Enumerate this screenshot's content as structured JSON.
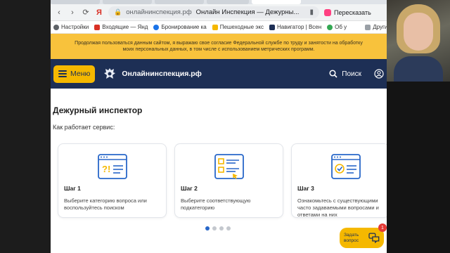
{
  "browser": {
    "url": "онлайнинспекция.рф",
    "page_title": "Онлайн Инспекция — Дежурны...",
    "retell_label": "Пересказать"
  },
  "bookmarks": [
    {
      "label": "Настройки",
      "color": "#5f6368"
    },
    {
      "label": "Входящие — Янд",
      "color": "#d93025"
    },
    {
      "label": "Бронирование ка",
      "color": "#1a73e8"
    },
    {
      "label": "Пешеходные экс",
      "color": "#f5b800"
    },
    {
      "label": "Навигатор | Всен",
      "color": "#1d2f55"
    },
    {
      "label": "Об у",
      "color": "#34a853"
    },
    {
      "label": "Другие закла",
      "color": "#5f6368"
    }
  ],
  "notice": {
    "text": "Продолжая пользоваться данным сайтом, я выражаю свое согласие Федеральной службе по труду и занятости на обработку моих персональных данных, в том числе с использованием метрических программ."
  },
  "header": {
    "menu_label": "Меню",
    "site_name": "Онлайнинспекция.рф",
    "search_label": "Поиск"
  },
  "main": {
    "title": "Дежурный инспектор",
    "subtitle": "Как работает сервис:",
    "steps": [
      {
        "label": "Шаг 1",
        "text": "Выберите категорию вопроса или воспользуйтесь поиском"
      },
      {
        "label": "Шаг 2",
        "text": "Выберите соответствующую подкатегорию"
      },
      {
        "label": "Шаг 3",
        "text": "Ознакомьтесь с существующими часто задаваемыми вопросами и ответами на них"
      }
    ],
    "active_dot": 0
  },
  "ask_button": {
    "label": "Задать вопрос",
    "badge": "1"
  },
  "colors": {
    "header_bg": "#1d2f55",
    "accent_yellow": "#f5b800",
    "notice_bg": "#f8c23c",
    "icon_blue": "#2867c9",
    "dot_active": "#2867c9",
    "badge_red": "#e53935"
  }
}
